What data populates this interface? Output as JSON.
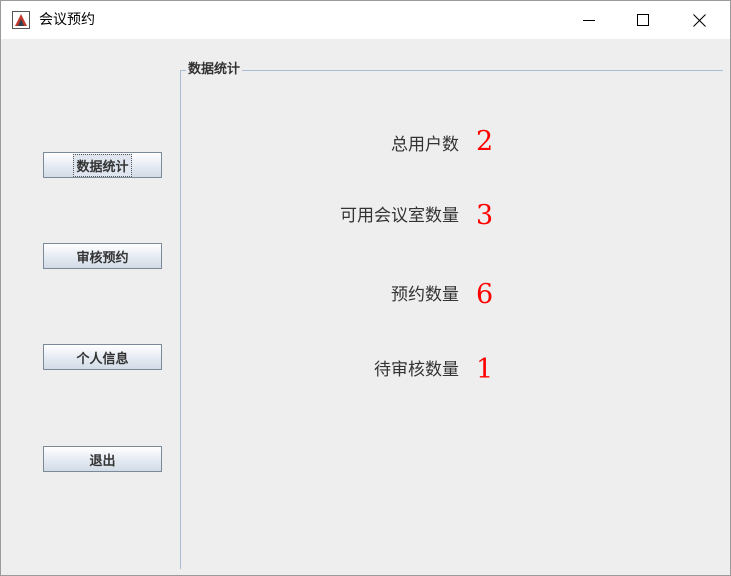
{
  "window": {
    "title": "会议预约"
  },
  "sidebar": {
    "buttons": [
      {
        "label": "数据统计"
      },
      {
        "label": "审核预约"
      },
      {
        "label": "个人信息"
      },
      {
        "label": "退出"
      }
    ]
  },
  "panel": {
    "title": "数据统计",
    "stats": [
      {
        "label": "总用户数",
        "value": "2"
      },
      {
        "label": "可用会议室数量",
        "value": "3"
      },
      {
        "label": "预约数量",
        "value": "6"
      },
      {
        "label": "待审核数量",
        "value": "1"
      }
    ]
  },
  "colors": {
    "value_color": "#ff0000",
    "panel_border": "#a8bed4",
    "background": "#eeeeee"
  }
}
